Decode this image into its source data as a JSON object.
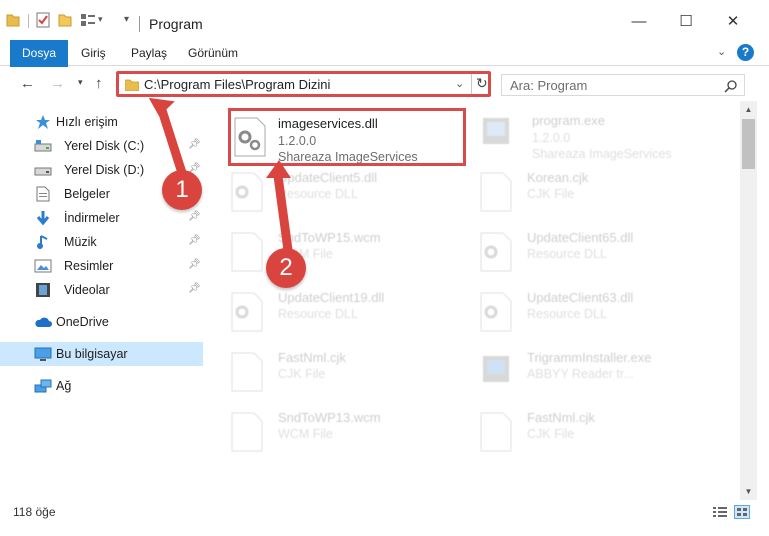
{
  "window": {
    "title": "Program"
  },
  "ribbon": {
    "tabs": [
      "Dosya",
      "Giriş",
      "Paylaş",
      "Görünüm"
    ]
  },
  "address": {
    "path": "C:\\Program Files\\Program Dizini"
  },
  "search": {
    "placeholder": "Ara: Program"
  },
  "sidebar": {
    "quick_access": "Hızlı erişim",
    "items": [
      {
        "label": "Yerel Disk (C:)",
        "icon": "drive-icon"
      },
      {
        "label": "Yerel Disk (D:)",
        "icon": "drive-icon"
      },
      {
        "label": "Belgeler",
        "icon": "documents-icon"
      },
      {
        "label": "İndirmeler",
        "icon": "downloads-icon"
      },
      {
        "label": "Müzik",
        "icon": "music-icon"
      },
      {
        "label": "Resimler",
        "icon": "pictures-icon"
      },
      {
        "label": "Videolar",
        "icon": "videos-icon"
      }
    ],
    "onedrive": "OneDrive",
    "this_pc": "Bu bilgisayar",
    "network": "Ağ"
  },
  "files": [
    {
      "name": "imageservices.dll",
      "line2": "1.2.0.0",
      "line3": "Shareaza ImageServices",
      "icon": "dll-file-icon"
    },
    {
      "name": "program.exe",
      "line2": "1.2.0.0",
      "line3": "Shareaza ImageServices",
      "icon": "exe-file-icon"
    },
    {
      "name": "UpdateClient5.dll",
      "line2": "Resource DLL",
      "line3": "",
      "icon": "dll-file-icon"
    },
    {
      "name": "Korean.cjk",
      "line2": "CJK File",
      "line3": "",
      "icon": "generic-file-icon"
    },
    {
      "name": "SndToWP15.wcm",
      "line2": "WCM File",
      "line3": "",
      "icon": "generic-file-icon"
    },
    {
      "name": "UpdateClient65.dll",
      "line2": "Resource DLL",
      "line3": "",
      "icon": "dll-file-icon"
    },
    {
      "name": "UpdateClient19.dll",
      "line2": "Resource DLL",
      "line3": "",
      "icon": "dll-file-icon"
    },
    {
      "name": "UpdateClient63.dll",
      "line2": "Resource DLL",
      "line3": "",
      "icon": "dll-file-icon"
    },
    {
      "name": "FastNml.cjk",
      "line2": "CJK File",
      "line3": "",
      "icon": "generic-file-icon"
    },
    {
      "name": "TrigrammInstaller.exe",
      "line2": "ABBYY Reader tr...",
      "line3": "",
      "icon": "exe-file-icon"
    },
    {
      "name": "SndToWP13.wcm",
      "line2": "WCM File",
      "line3": "",
      "icon": "generic-file-icon"
    },
    {
      "name": "FastNml.cjk",
      "line2": "CJK File",
      "line3": "",
      "icon": "generic-file-icon"
    }
  ],
  "status": {
    "item_count": "118 öğe"
  },
  "annotations": {
    "badge1": "1",
    "badge2": "2"
  },
  "colors": {
    "accent": "#1979ca",
    "highlight_red": "#d94b4b",
    "selection": "#cce8ff"
  }
}
